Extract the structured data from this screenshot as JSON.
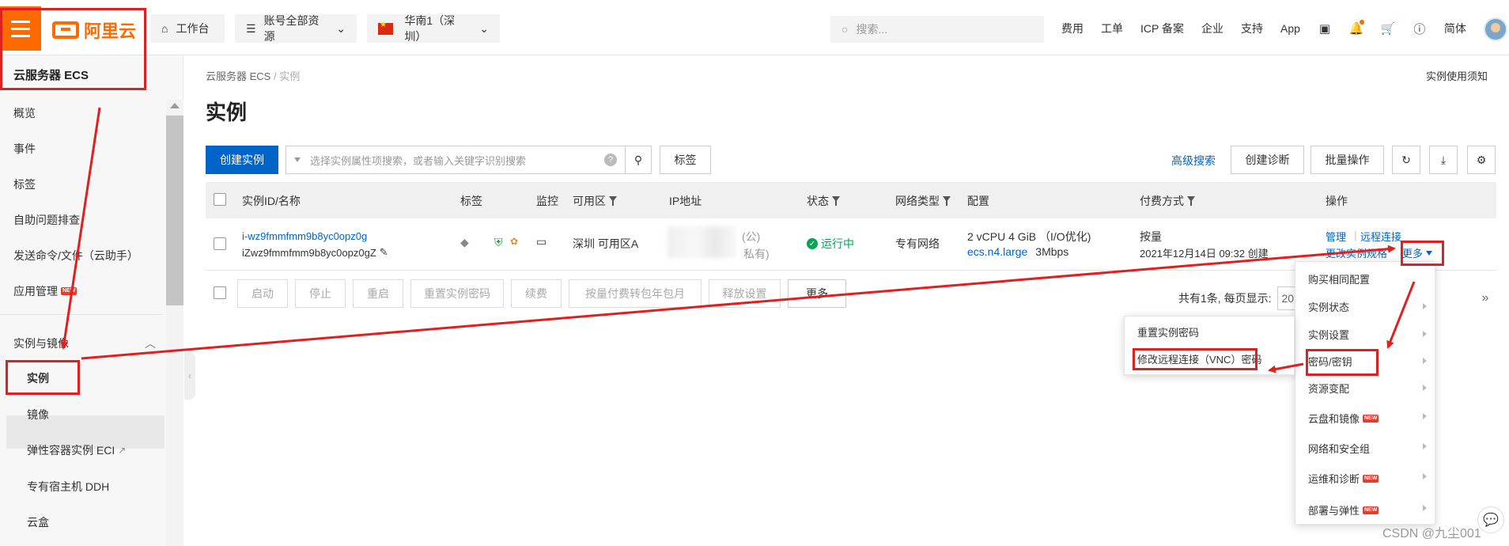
{
  "topbar": {
    "logo_text": "阿里云",
    "workbench": "工作台",
    "resources": "账号全部资源",
    "region": "华南1（深圳）",
    "search_placeholder": "搜索...",
    "links": [
      "费用",
      "工单",
      "ICP 备案",
      "企业",
      "支持",
      "App"
    ],
    "lang": "简体",
    "icons": [
      "terminal-icon",
      "bell-icon",
      "cart-icon",
      "help-icon"
    ]
  },
  "sidebar": {
    "title": "云服务器 ECS",
    "items": [
      "概览",
      "事件",
      "标签",
      "自助问题排查",
      "发送命令/文件（云助手）",
      "应用管理"
    ],
    "new_badge": "NEW",
    "group": "实例与镜像",
    "sub_items": [
      "实例",
      "镜像",
      "弹性容器实例 ECI",
      "专有宿主机 DDH",
      "云盒"
    ]
  },
  "main": {
    "breadcrumb": [
      "云服务器 ECS",
      "/",
      "实例"
    ],
    "notice": "实例使用须知",
    "title": "实例",
    "create_button": "创建实例",
    "filter_placeholder": "选择实例属性项搜索，或者输入关键字识别搜索",
    "tag_button": "标签",
    "advanced_search": "高级搜索",
    "diag_button": "创建诊断",
    "batch_button": "批量操作"
  },
  "table": {
    "headers": [
      "实例ID/名称",
      "标签",
      "监控",
      "可用区",
      "IP地址",
      "状态",
      "网络类型",
      "配置",
      "付费方式",
      "操作"
    ],
    "row": {
      "id": "i-wz9fmmfmm9b8yc0opz0g",
      "name": "iZwz9fmmfmm9b8yc0opz0gZ",
      "zone": "深圳 可用区A",
      "ip_public": "(公)",
      "ip_private": "私有)",
      "status": "运行中",
      "network": "专有网络",
      "config_line1": "2 vCPU 4 GiB （I/O优化)",
      "config_type": "ecs.n4.large",
      "config_bw": "3Mbps",
      "billing": "按量",
      "created": "2021年12月14日 09:32 创建",
      "op_manage": "管理",
      "op_remote": "远程连接",
      "op_change": "更改实例规格",
      "op_more": "更多"
    }
  },
  "bulk_actions": [
    "启动",
    "停止",
    "重启",
    "重置实例密码",
    "续费",
    "按量付费转包年包月",
    "释放设置",
    "更多"
  ],
  "pager": {
    "summary": "共有1条, 每页显示:",
    "size": "20",
    "next": "»"
  },
  "more_menu": [
    {
      "label": "购买相同配置",
      "arrow": false,
      "new": false
    },
    {
      "label": "实例状态",
      "arrow": true,
      "new": false
    },
    {
      "label": "实例设置",
      "arrow": true,
      "new": false
    },
    {
      "label": "密码/密钥",
      "arrow": true,
      "new": false
    },
    {
      "label": "资源变配",
      "arrow": true,
      "new": false
    },
    {
      "label": "云盘和镜像",
      "arrow": true,
      "new": true
    },
    {
      "label": "网络和安全组",
      "arrow": true,
      "new": false
    },
    {
      "label": "运维和诊断",
      "arrow": true,
      "new": true
    },
    {
      "label": "部署与弹性",
      "arrow": true,
      "new": true
    }
  ],
  "sub_menu": [
    "重置实例密码",
    "修改远程连接（VNC）密码"
  ],
  "watermark": "CSDN @九尘001",
  "colors": {
    "brand": "#ff6a00",
    "primary": "#0064c8",
    "annotation": "#e02020",
    "running": "#00a854"
  }
}
